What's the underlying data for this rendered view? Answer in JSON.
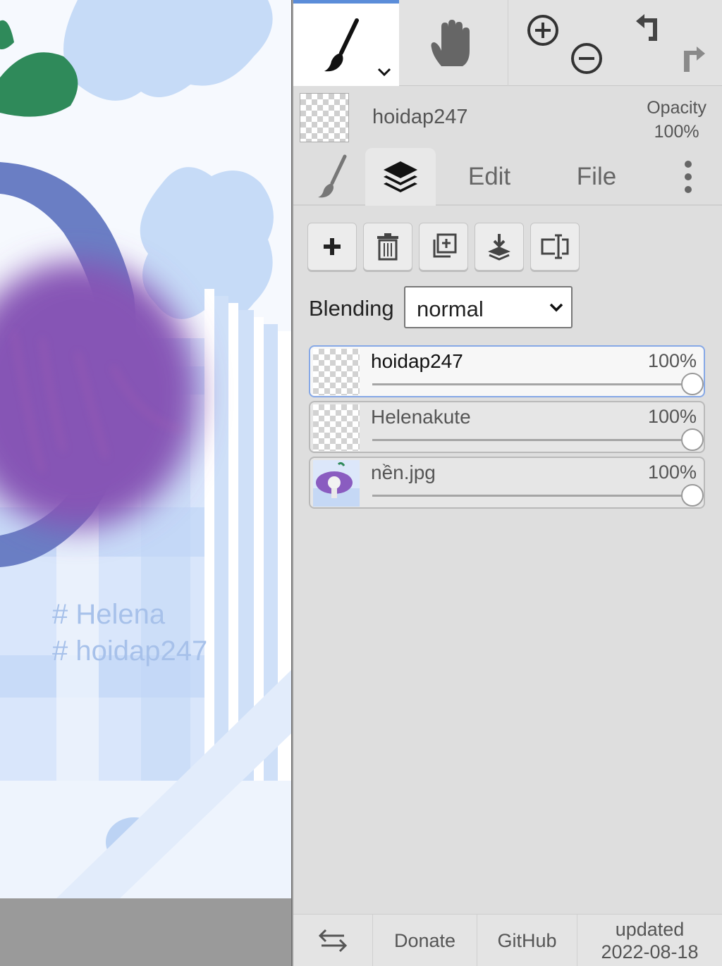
{
  "canvas": {
    "hashtags": [
      "# Helena",
      "# hoidap247"
    ]
  },
  "toolbar": {
    "tools": [
      "brush-icon",
      "hand-icon",
      "zoom-in-icon",
      "zoom-out-icon",
      "undo-icon",
      "redo-icon"
    ],
    "active_tool": "brush"
  },
  "layer_info": {
    "name": "hoidap247",
    "opacity_label": "Opacity",
    "opacity_value": "100%"
  },
  "tabs": [
    {
      "icon": "brush-icon"
    },
    {
      "icon": "layers-icon",
      "active": true
    },
    {
      "label": "Edit"
    },
    {
      "label": "File"
    },
    {
      "icon": "more-vertical-icon"
    }
  ],
  "layer_actions": [
    "add-layer-icon",
    "delete-layer-icon",
    "duplicate-layer-icon",
    "merge-down-icon",
    "rename-layer-icon"
  ],
  "blending": {
    "label": "Blending",
    "value": "normal"
  },
  "layers": [
    {
      "name": "hoidap247",
      "opacity": "100%",
      "opacity_fraction": 1.0,
      "active": true
    },
    {
      "name": "Helenakute",
      "opacity": "100%",
      "opacity_fraction": 1.0,
      "active": false
    },
    {
      "name": "nền.jpg",
      "opacity": "100%",
      "opacity_fraction": 1.0,
      "active": false
    }
  ],
  "footer": {
    "swap_icon": "swap-arrows-icon",
    "donate": "Donate",
    "github": "GitHub",
    "updated_label": "updated",
    "updated_date": "2022-08-18"
  },
  "colors": {
    "accent": "#5b8dd9",
    "panel_bg": "#dedede",
    "active_layer_border": "#86a8e6"
  }
}
